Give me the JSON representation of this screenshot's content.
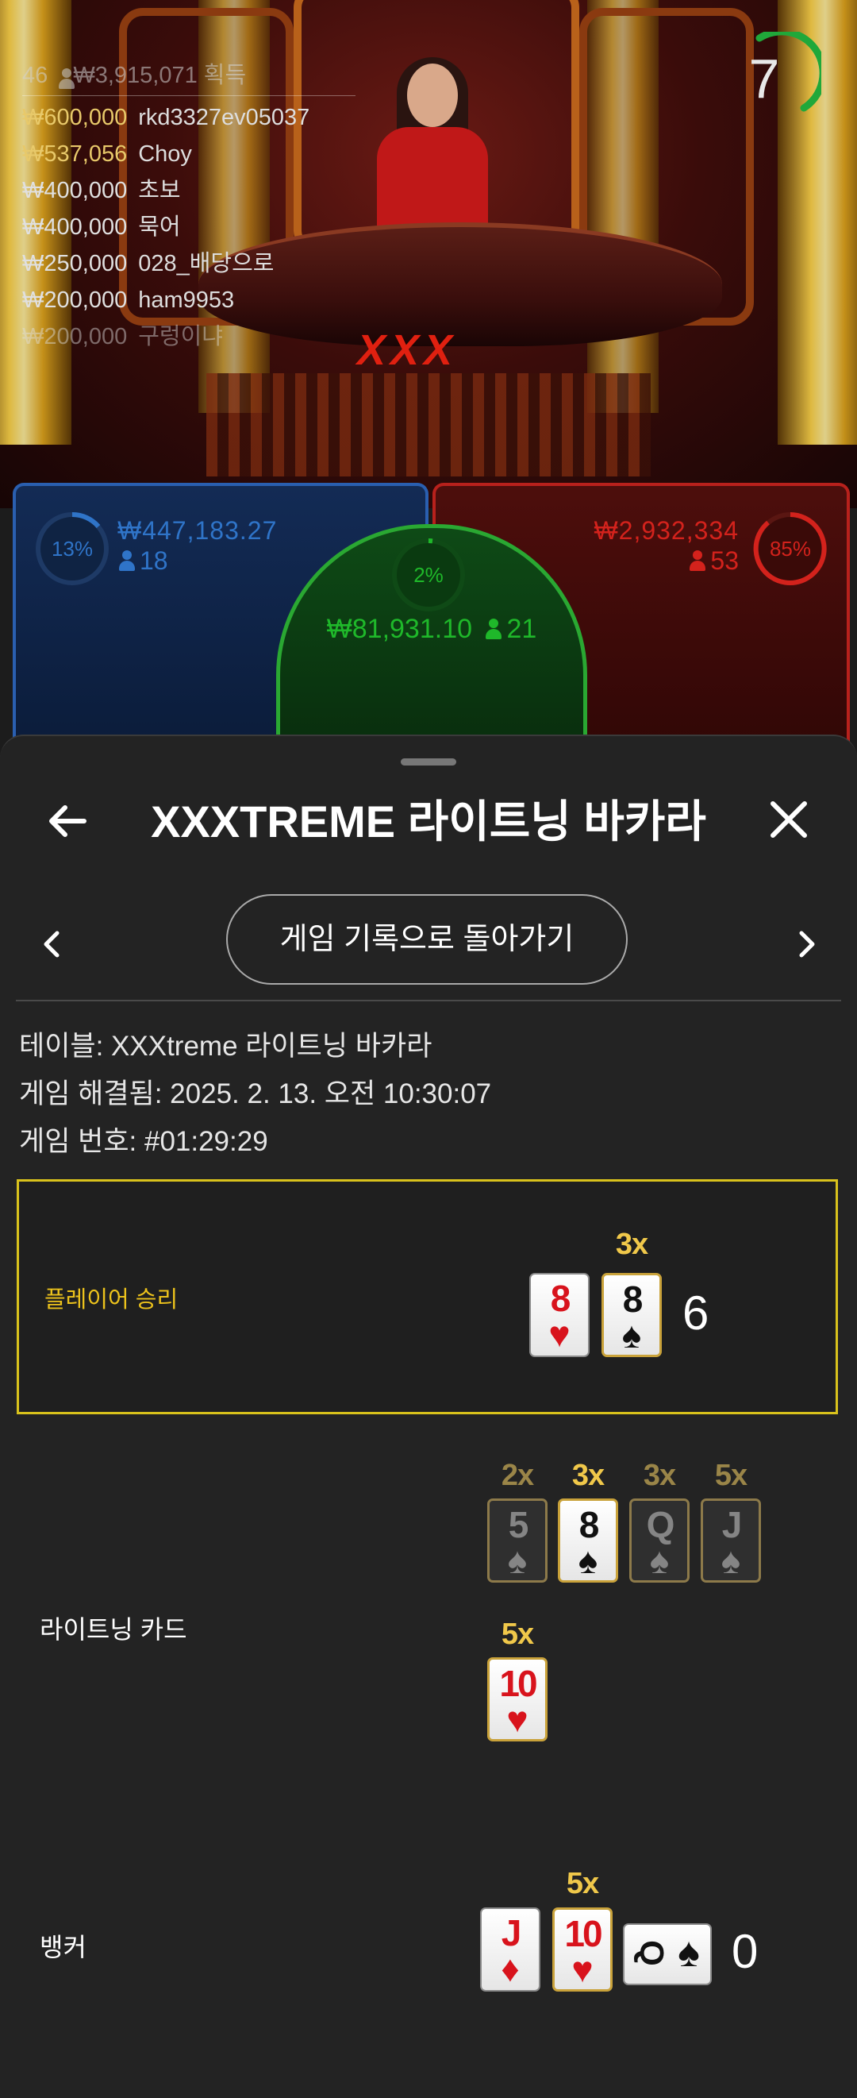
{
  "video": {
    "logo_text": "XXX",
    "timer": "7",
    "winners": {
      "count": "46",
      "total": "₩3,915,071",
      "total_label": "획득",
      "rows": [
        {
          "amount": "₩600,000",
          "name": "rkd3327ev05037"
        },
        {
          "amount": "₩537,056",
          "name": "Choy"
        },
        {
          "amount": "₩400,000",
          "name": "초보"
        },
        {
          "amount": "₩400,000",
          "name": "묵어"
        },
        {
          "amount": "₩250,000",
          "name": "028_배당으로"
        },
        {
          "amount": "₩200,000",
          "name": "ham9953"
        },
        {
          "amount": "₩200,000",
          "name": "구렁이냐"
        }
      ]
    }
  },
  "bets": {
    "player": {
      "percent": "13%",
      "amount": "₩447,183.27",
      "count": "18",
      "color": "#2f74c8"
    },
    "tie": {
      "percent": "2%",
      "amount": "₩81,931.10",
      "count": "21",
      "color": "#1fb82a"
    },
    "banker": {
      "percent": "85%",
      "amount": "₩2,932,334",
      "count": "53",
      "color": "#d3221c"
    }
  },
  "sheet": {
    "title": "XXXTREME 라이트닝 바카라",
    "back_to_history": "게임 기록으로 돌아가기",
    "info": {
      "table": "테이블: XXXtreme 라이트닝 바카라",
      "resolved": "게임 해결됨: 2025. 2. 13. 오전 10:30:07",
      "game_no": "게임 번호: #01:29:29"
    },
    "result": {
      "label": "플레이어 승리",
      "label_color": "#ecc21c",
      "cards": [
        {
          "rank": "8",
          "suit": "♥",
          "color": "red",
          "multiplier": ""
        },
        {
          "rank": "8",
          "suit": "♠",
          "color": "black",
          "multiplier": "3x"
        }
      ],
      "score": "6"
    },
    "lightning": {
      "label": "라이트닝 카드",
      "cards": [
        {
          "rank": "5",
          "suit": "♠",
          "multiplier": "2x",
          "state": "dim"
        },
        {
          "rank": "8",
          "suit": "♠",
          "multiplier": "3x",
          "state": "active"
        },
        {
          "rank": "Q",
          "suit": "♠",
          "multiplier": "3x",
          "state": "dim"
        },
        {
          "rank": "J",
          "suit": "♠",
          "multiplier": "5x",
          "state": "dim"
        },
        {
          "rank": "10",
          "suit": "♥",
          "multiplier": "5x",
          "state": "active"
        }
      ]
    },
    "banker": {
      "label": "뱅커",
      "cards": [
        {
          "rank": "J",
          "suit": "♦",
          "color": "red",
          "multiplier": ""
        },
        {
          "rank": "10",
          "suit": "♥",
          "color": "red",
          "multiplier": "5x"
        },
        {
          "rank": "Q",
          "suit": "♠",
          "color": "black",
          "multiplier": ""
        }
      ],
      "score": "0"
    }
  }
}
